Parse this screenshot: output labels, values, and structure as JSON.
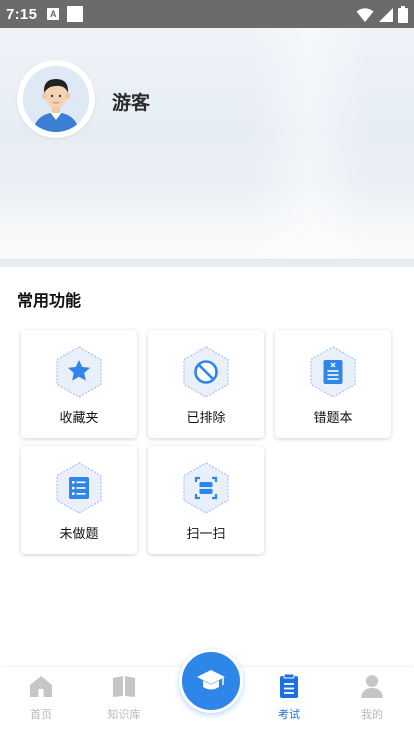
{
  "status_bar": {
    "time": "7:15",
    "notification_glyph": "A"
  },
  "profile": {
    "name": "游客"
  },
  "section": {
    "title": "常用功能"
  },
  "functions": [
    {
      "label": "收藏夹",
      "icon": "star-icon"
    },
    {
      "label": "已排除",
      "icon": "ban-icon"
    },
    {
      "label": "错题本",
      "icon": "notebook-icon"
    },
    {
      "label": "未做题",
      "icon": "checklist-icon"
    },
    {
      "label": "扫一扫",
      "icon": "scan-icon"
    }
  ],
  "tabbar": {
    "items": [
      {
        "label": "首页",
        "icon": "home-icon",
        "active": false
      },
      {
        "label": "知识库",
        "icon": "book-icon",
        "active": false
      },
      {
        "label": "考试",
        "icon": "exam-clipboard-icon",
        "active": true
      },
      {
        "label": "我的",
        "icon": "person-icon",
        "active": false
      }
    ],
    "center_icon": "graduation-cap-icon"
  },
  "colors": {
    "accent": "#1b6fe3",
    "inactive": "#b9b9b9",
    "hex_fill": "#e9f0fb",
    "hex_stroke": "#a9c4ea"
  }
}
